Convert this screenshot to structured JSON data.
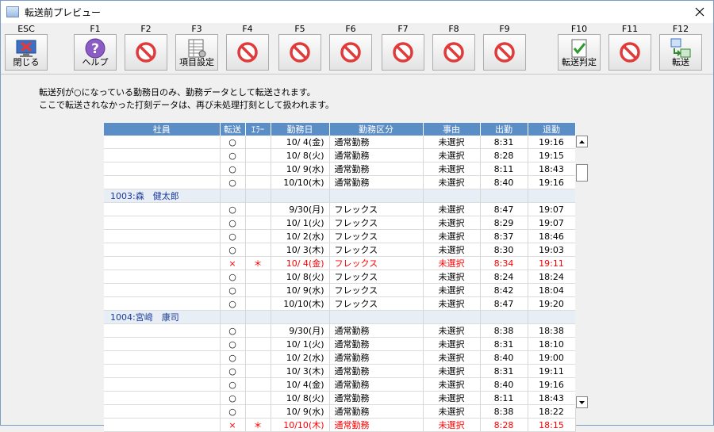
{
  "window": {
    "title": "転送前プレビュー"
  },
  "toolbar": [
    {
      "key": "ESC",
      "label": "閉じる",
      "icon": "close-screen-icon"
    },
    {
      "key": "F1",
      "label": "ヘルプ",
      "icon": "help-icon"
    },
    {
      "key": "F2",
      "label": "",
      "icon": "prohibited-icon"
    },
    {
      "key": "F3",
      "label": "項目設定",
      "icon": "item-settings-icon"
    },
    {
      "key": "F4",
      "label": "",
      "icon": "prohibited-icon"
    },
    {
      "key": "F5",
      "label": "",
      "icon": "prohibited-icon"
    },
    {
      "key": "F6",
      "label": "",
      "icon": "prohibited-icon"
    },
    {
      "key": "F7",
      "label": "",
      "icon": "prohibited-icon"
    },
    {
      "key": "F8",
      "label": "",
      "icon": "prohibited-icon"
    },
    {
      "key": "F9",
      "label": "",
      "icon": "prohibited-icon"
    },
    {
      "key": "F10",
      "label": "転送判定",
      "icon": "transfer-check-icon"
    },
    {
      "key": "F11",
      "label": "",
      "icon": "prohibited-icon"
    },
    {
      "key": "F12",
      "label": "転送",
      "icon": "transfer-icon"
    }
  ],
  "message": {
    "line1": "転送列が○になっている勤務日のみ、勤務データとして転送されます。",
    "line2": "ここで転送されなかった打刻データは、再び未処理打刻として扱われます。"
  },
  "columns": [
    "社員",
    "転送",
    "ｴﾗｰ",
    "勤務日",
    "勤務区分",
    "事由",
    "出勤",
    "退勤"
  ],
  "colors": {
    "header": "#5b8dc6",
    "error": "#ff0000",
    "group_text": "#1a3a9c"
  },
  "rows": [
    {
      "type": "data",
      "transfer": "○",
      "error": "",
      "date": "10/ 4(金)",
      "kubun": "通常勤務",
      "reason": "未選択",
      "in": "8:31",
      "out": "19:16"
    },
    {
      "type": "data",
      "transfer": "○",
      "error": "",
      "date": "10/ 8(火)",
      "kubun": "通常勤務",
      "reason": "未選択",
      "in": "8:28",
      "out": "19:15"
    },
    {
      "type": "data",
      "transfer": "○",
      "error": "",
      "date": "10/ 9(水)",
      "kubun": "通常勤務",
      "reason": "未選択",
      "in": "8:11",
      "out": "18:43"
    },
    {
      "type": "data",
      "transfer": "○",
      "error": "",
      "date": "10/10(木)",
      "kubun": "通常勤務",
      "reason": "未選択",
      "in": "8:40",
      "out": "19:16"
    },
    {
      "type": "group",
      "name": "1003:森　健太郎"
    },
    {
      "type": "data",
      "transfer": "○",
      "error": "",
      "date": "9/30(月)",
      "kubun": "フレックス",
      "reason": "未選択",
      "in": "8:47",
      "out": "19:07"
    },
    {
      "type": "data",
      "transfer": "○",
      "error": "",
      "date": "10/ 1(火)",
      "kubun": "フレックス",
      "reason": "未選択",
      "in": "8:29",
      "out": "19:07"
    },
    {
      "type": "data",
      "transfer": "○",
      "error": "",
      "date": "10/ 2(水)",
      "kubun": "フレックス",
      "reason": "未選択",
      "in": "8:37",
      "out": "18:46"
    },
    {
      "type": "data",
      "transfer": "○",
      "error": "",
      "date": "10/ 3(木)",
      "kubun": "フレックス",
      "reason": "未選択",
      "in": "8:30",
      "out": "19:03"
    },
    {
      "type": "error",
      "transfer": "×",
      "error": "＊",
      "date": "10/ 4(金)",
      "kubun": "フレックス",
      "reason": "未選択",
      "in": "8:34",
      "out": "19:11"
    },
    {
      "type": "data",
      "transfer": "○",
      "error": "",
      "date": "10/ 8(火)",
      "kubun": "フレックス",
      "reason": "未選択",
      "in": "8:24",
      "out": "18:24"
    },
    {
      "type": "data",
      "transfer": "○",
      "error": "",
      "date": "10/ 9(水)",
      "kubun": "フレックス",
      "reason": "未選択",
      "in": "8:42",
      "out": "18:04"
    },
    {
      "type": "data",
      "transfer": "○",
      "error": "",
      "date": "10/10(木)",
      "kubun": "フレックス",
      "reason": "未選択",
      "in": "8:47",
      "out": "19:20"
    },
    {
      "type": "group",
      "name": "1004:宮﨑　康司"
    },
    {
      "type": "data",
      "transfer": "○",
      "error": "",
      "date": "9/30(月)",
      "kubun": "通常勤務",
      "reason": "未選択",
      "in": "8:38",
      "out": "18:38"
    },
    {
      "type": "data",
      "transfer": "○",
      "error": "",
      "date": "10/ 1(火)",
      "kubun": "通常勤務",
      "reason": "未選択",
      "in": "8:31",
      "out": "18:10"
    },
    {
      "type": "data",
      "transfer": "○",
      "error": "",
      "date": "10/ 2(水)",
      "kubun": "通常勤務",
      "reason": "未選択",
      "in": "8:40",
      "out": "19:00"
    },
    {
      "type": "data",
      "transfer": "○",
      "error": "",
      "date": "10/ 3(木)",
      "kubun": "通常勤務",
      "reason": "未選択",
      "in": "8:31",
      "out": "19:11"
    },
    {
      "type": "data",
      "transfer": "○",
      "error": "",
      "date": "10/ 4(金)",
      "kubun": "通常勤務",
      "reason": "未選択",
      "in": "8:40",
      "out": "19:16"
    },
    {
      "type": "data",
      "transfer": "○",
      "error": "",
      "date": "10/ 8(火)",
      "kubun": "通常勤務",
      "reason": "未選択",
      "in": "8:11",
      "out": "18:43"
    },
    {
      "type": "data",
      "transfer": "○",
      "error": "",
      "date": "10/ 9(水)",
      "kubun": "通常勤務",
      "reason": "未選択",
      "in": "8:38",
      "out": "18:22"
    },
    {
      "type": "error",
      "transfer": "×",
      "error": "＊",
      "date": "10/10(木)",
      "kubun": "通常勤務",
      "reason": "未選択",
      "in": "8:28",
      "out": "18:15"
    }
  ]
}
